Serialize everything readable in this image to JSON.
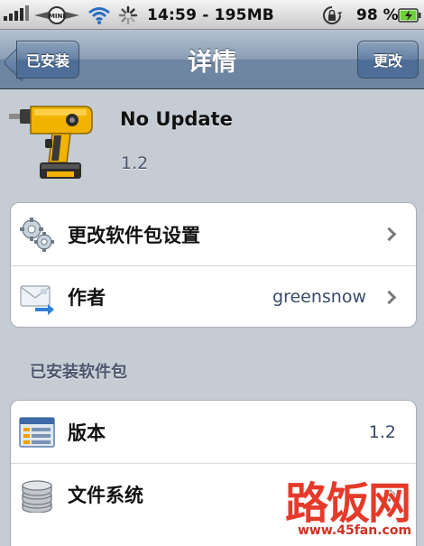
{
  "status_bar": {
    "carrier": "MINI",
    "time_memory": "14:59 - 195MB",
    "battery_percent": "98 %"
  },
  "nav": {
    "back_label": "已安装",
    "title": "详情",
    "edit_label": "更改"
  },
  "package": {
    "name": "No Update",
    "version": "1.2",
    "icon": "power-drill-icon"
  },
  "group1": [
    {
      "label": "更改软件包设置",
      "value": "",
      "icon": "gears-icon",
      "chevron": true
    },
    {
      "label": "作者",
      "value": "greensnow",
      "icon": "mail-icon",
      "chevron": true
    }
  ],
  "section_header": "已安装软件包",
  "group2": [
    {
      "label": "版本",
      "value": "1.2",
      "icon": "version-list-icon",
      "chevron": false
    },
    {
      "label": "文件系统",
      "value": "",
      "icon": "database-icon",
      "chevron": true
    }
  ],
  "watermark": {
    "main": "路饭网",
    "url": "www.45fan.com"
  },
  "colors": {
    "nav_blue": "#6d85a1",
    "background": "#c5ccd4",
    "watermark_red": "#e53a2a"
  }
}
